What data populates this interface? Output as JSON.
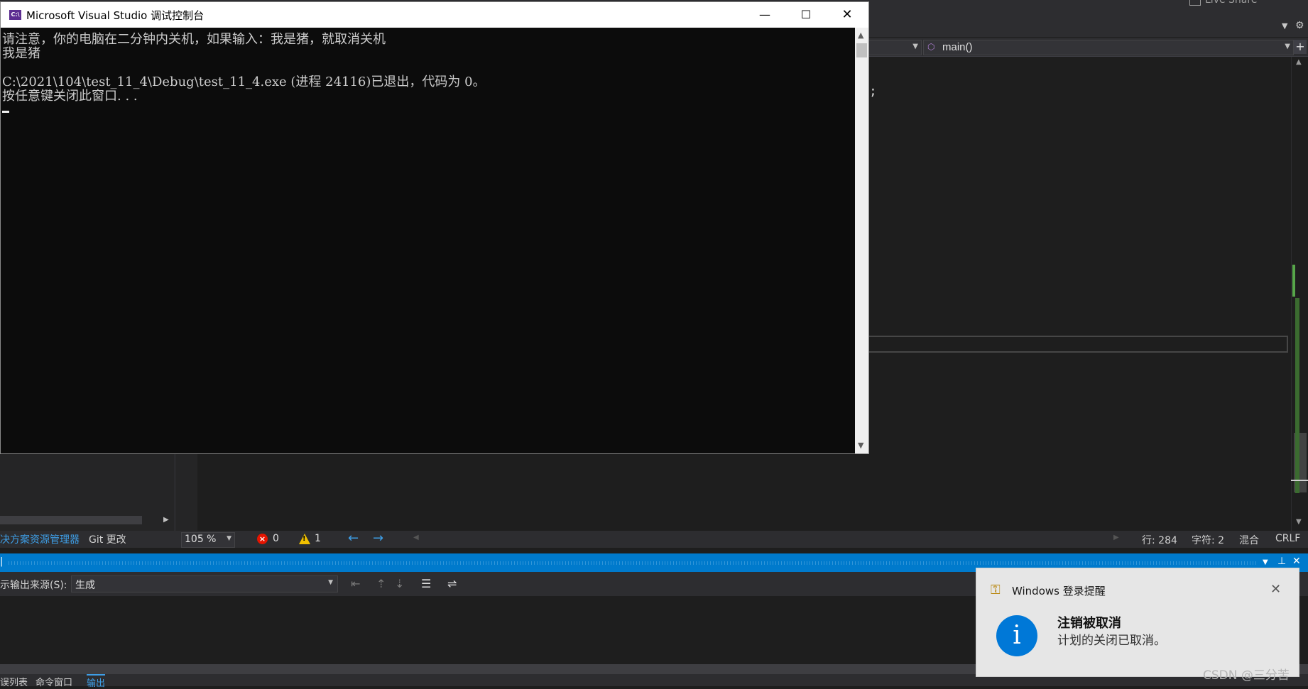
{
  "ide": {
    "live_share": "Live Share",
    "nav_function": "main()",
    "code_fragment": ";",
    "solution_explorer_tab": "决方案资源管理器",
    "git_tab": "Git 更改",
    "zoom": "105 %",
    "errors": "0",
    "warnings": "1",
    "status": {
      "line": "行: 284",
      "col": "字符: 2",
      "mode": "混合",
      "eol": "CRLF"
    },
    "output": {
      "source_label": "示输出来源(S):",
      "source_value": "生成"
    },
    "bottom_tabs": [
      "误列表",
      "命令窗口",
      "输出"
    ]
  },
  "console": {
    "title": "Microsoft Visual Studio 调试控制台",
    "lines": [
      "请注意，你的电脑在二分钟内关机，如果输入：我是猪，就取消关机",
      "我是猪",
      "",
      "C:\\2021\\104\\test_11_4\\Debug\\test_11_4.exe (进程 24116)已退出，代码为 0。",
      "按任意键关闭此窗口. . ."
    ]
  },
  "toast": {
    "app": "Windows 登录提醒",
    "heading": "注销被取消",
    "message": "计划的关闭已取消。"
  },
  "watermark": "CSDN @三分苦",
  "colors": {
    "accent": "#007acc",
    "console_bg": "#0c0c0c",
    "toast_info": "#0078d7",
    "error": "#e51400",
    "warning": "#f0c000"
  }
}
